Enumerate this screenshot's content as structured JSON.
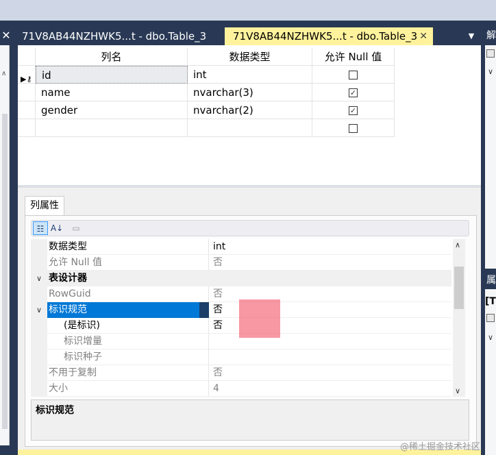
{
  "tabs": {
    "inactive_label": "71V8AB44NZHWK5...t - dbo.Table_3",
    "active_label": "71V8AB44NZHWK5...t - dbo.Table_3",
    "close_glyph": "✕",
    "menu_glyph": "▼"
  },
  "left_pane": {
    "close_glyph": "✕"
  },
  "table_grid": {
    "headers": [
      "列名",
      "数据类型",
      "允许 Null 值"
    ],
    "rows": [
      {
        "name": "id",
        "type": "int",
        "allow_null": false
      },
      {
        "name": "name",
        "type": "nvarchar(3)",
        "allow_null": true
      },
      {
        "name": "gender",
        "type": "nvarchar(2)",
        "allow_null": true
      },
      {
        "name": "",
        "type": "",
        "allow_null": false
      }
    ],
    "check_glyph": "✓"
  },
  "props": {
    "tab_label": "列属性",
    "rows": [
      {
        "name": "数据类型",
        "value": "int"
      },
      {
        "name": "允许 Null 值",
        "value": "否"
      },
      {
        "name": "表设计器",
        "value": ""
      },
      {
        "name": "RowGuid",
        "value": "否"
      },
      {
        "name": "标识规范",
        "value": "否"
      },
      {
        "name": "(是标识)",
        "value": "否"
      },
      {
        "name": "标识增量",
        "value": ""
      },
      {
        "name": "标识种子",
        "value": ""
      },
      {
        "name": "不用于复制",
        "value": "否"
      },
      {
        "name": "大小",
        "value": "4"
      }
    ],
    "description_title": "标识规范"
  },
  "right_pane": {
    "header1": "解",
    "header2": "属",
    "item2": "[T"
  },
  "watermark": "@稀土掘金技术社区"
}
